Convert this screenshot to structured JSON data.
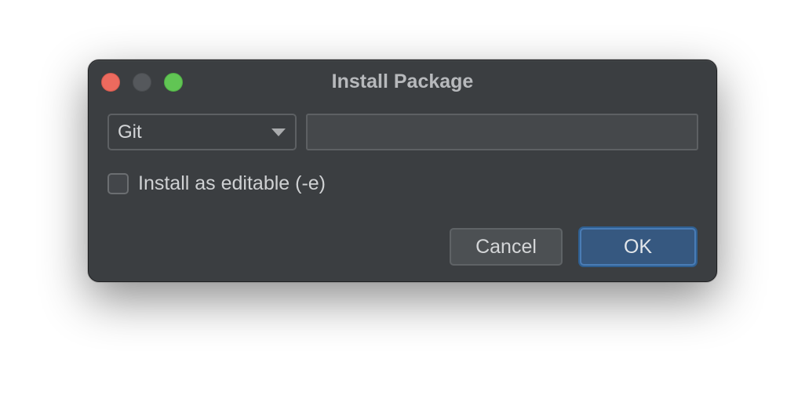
{
  "window": {
    "title": "Install Package"
  },
  "form": {
    "vcs_select": {
      "selected": "Git"
    },
    "url_input": {
      "value": "",
      "placeholder": ""
    },
    "editable_checkbox": {
      "label": "Install as editable (-e)",
      "checked": false
    }
  },
  "buttons": {
    "cancel_label": "Cancel",
    "ok_label": "OK"
  },
  "colors": {
    "dialog_bg": "#3b3e41",
    "primary_button": "#365880",
    "close": "#ec6a5e",
    "minimize_disabled": "#55585c",
    "maximize": "#61c554"
  },
  "icons": {
    "close": "close-circle-icon",
    "minimize": "minimize-circle-icon",
    "maximize": "maximize-circle-icon",
    "dropdown": "caret-down-icon"
  }
}
